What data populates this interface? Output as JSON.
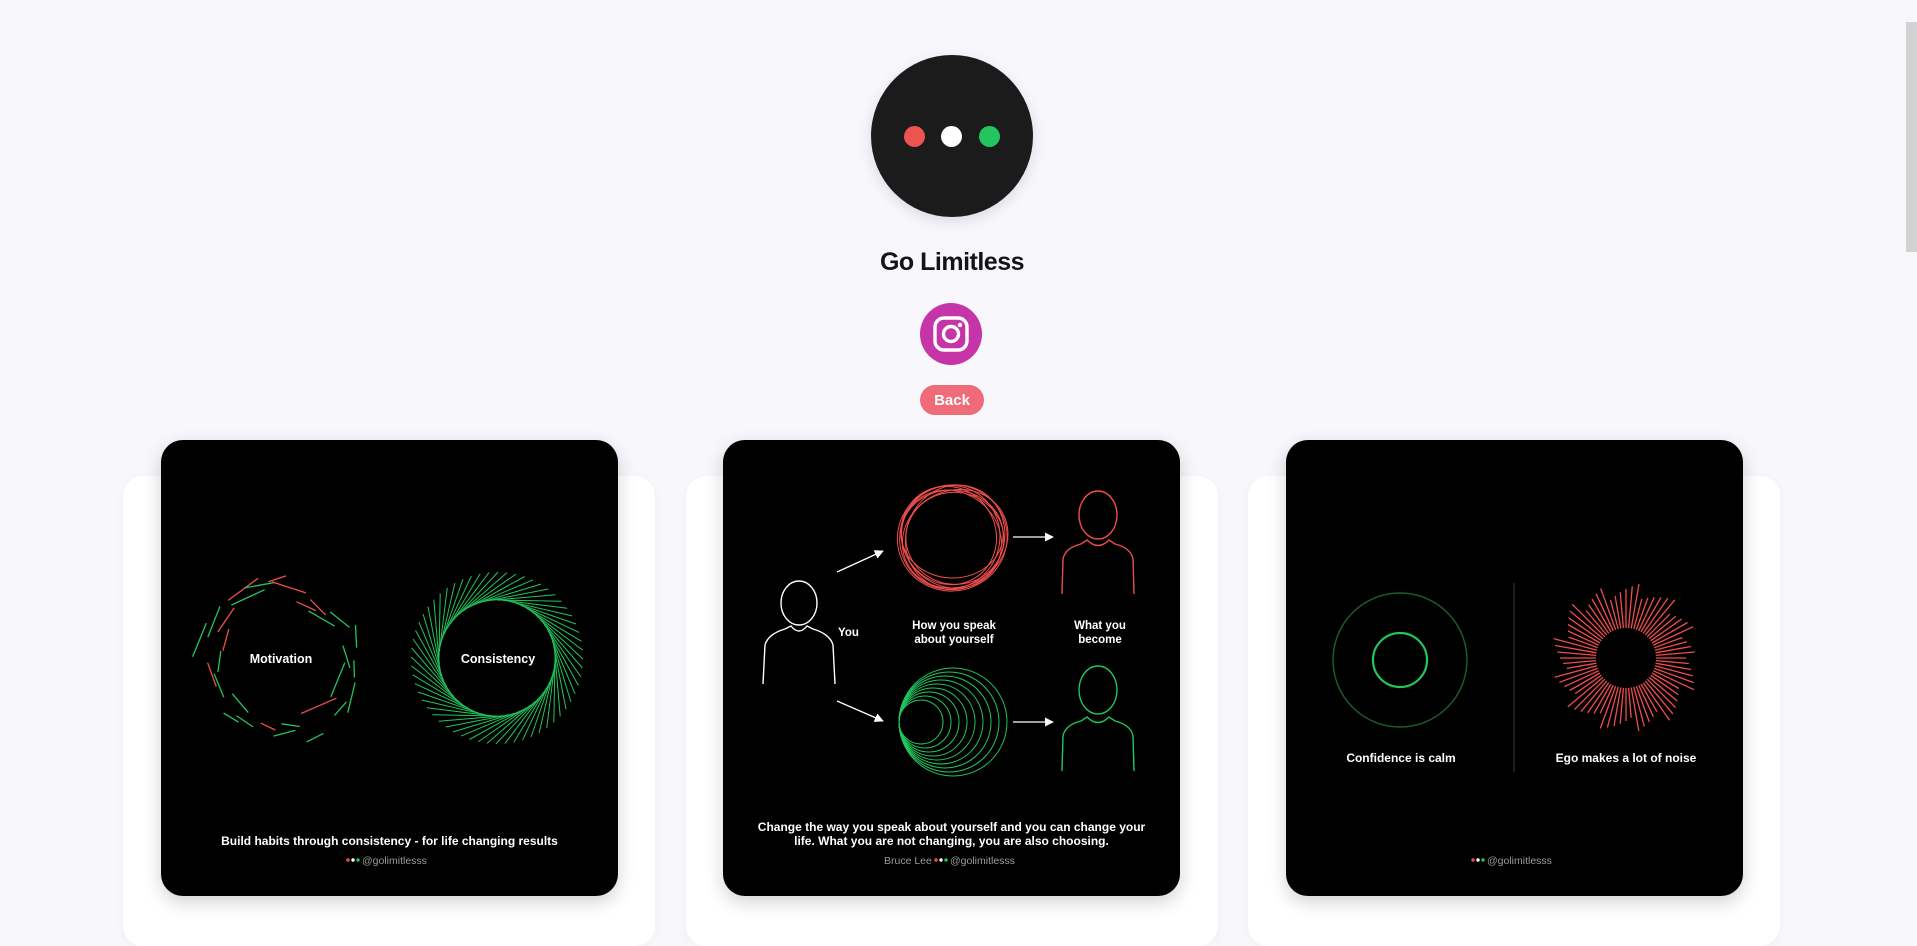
{
  "profile": {
    "name": "Go Limitless",
    "avatar_dots": [
      "#ef5350",
      "#ffffff",
      "#22c55e"
    ]
  },
  "social": {
    "instagram_icon": "instagram-icon",
    "color": "#c535a8"
  },
  "back_button": {
    "label": "Back",
    "color": "#f06b78"
  },
  "colors": {
    "red": "#ef4d4d",
    "green": "#22c55e",
    "card_bg": "#000000"
  },
  "posts": [
    {
      "left_label": "Motivation",
      "right_label": "Consistency",
      "caption": "Build habits through consistency - for life changing results",
      "handle": "@golimitlesss"
    },
    {
      "you_label": "You",
      "speak_label_1": "How you speak",
      "speak_label_2": "about yourself",
      "become_label_1": "What you",
      "become_label_2": "become",
      "caption_1": "Change the way you speak about yourself and you can change your",
      "caption_2": "life. What you are not changing, you are also choosing.",
      "author": "Bruce Lee",
      "handle": "@golimitlesss"
    },
    {
      "left_label": "Confidence is calm",
      "right_label": "Ego makes a lot of noise",
      "handle": "@golimitlesss"
    }
  ]
}
